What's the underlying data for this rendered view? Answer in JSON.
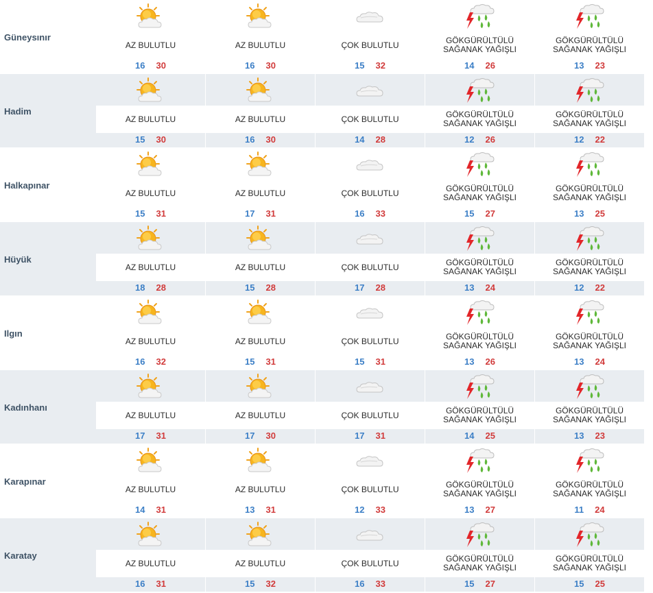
{
  "colors": {
    "low": "#3c7fc6",
    "high": "#d13b3b",
    "city": "#3f5366"
  },
  "cities": [
    {
      "name": "Güneysınır",
      "days": [
        {
          "icon": "sun-cloud-icon",
          "desc": "AZ BULUTLU",
          "low": "16",
          "high": "30"
        },
        {
          "icon": "sun-cloud-icon",
          "desc": "AZ BULUTLU",
          "low": "16",
          "high": "30"
        },
        {
          "icon": "cloud-icon",
          "desc": "ÇOK BULUTLU",
          "low": "15",
          "high": "32"
        },
        {
          "icon": "thunder-rain-icon",
          "desc": "GÖKGÜRÜLTÜLÜ\nSAĞANAK YAĞIŞLI",
          "low": "14",
          "high": "26"
        },
        {
          "icon": "thunder-rain-icon",
          "desc": "GÖKGÜRÜLTÜLÜ\nSAĞANAK YAĞIŞLI",
          "low": "13",
          "high": "23"
        }
      ]
    },
    {
      "name": "Hadim",
      "days": [
        {
          "icon": "sun-cloud-icon",
          "desc": "AZ BULUTLU",
          "low": "15",
          "high": "30"
        },
        {
          "icon": "sun-cloud-icon",
          "desc": "AZ BULUTLU",
          "low": "16",
          "high": "30"
        },
        {
          "icon": "cloud-icon",
          "desc": "ÇOK BULUTLU",
          "low": "14",
          "high": "28"
        },
        {
          "icon": "thunder-rain-icon",
          "desc": "GÖKGÜRÜLTÜLÜ\nSAĞANAK YAĞIŞLI",
          "low": "12",
          "high": "26"
        },
        {
          "icon": "thunder-rain-icon",
          "desc": "GÖKGÜRÜLTÜLÜ\nSAĞANAK YAĞIŞLI",
          "low": "12",
          "high": "22"
        }
      ]
    },
    {
      "name": "Halkapınar",
      "days": [
        {
          "icon": "sun-cloud-icon",
          "desc": "AZ BULUTLU",
          "low": "15",
          "high": "31"
        },
        {
          "icon": "sun-cloud-icon",
          "desc": "AZ BULUTLU",
          "low": "17",
          "high": "31"
        },
        {
          "icon": "cloud-icon",
          "desc": "ÇOK BULUTLU",
          "low": "16",
          "high": "33"
        },
        {
          "icon": "thunder-rain-icon",
          "desc": "GÖKGÜRÜLTÜLÜ\nSAĞANAK YAĞIŞLI",
          "low": "15",
          "high": "27"
        },
        {
          "icon": "thunder-rain-icon",
          "desc": "GÖKGÜRÜLTÜLÜ\nSAĞANAK YAĞIŞLI",
          "low": "13",
          "high": "25"
        }
      ]
    },
    {
      "name": "Hüyük",
      "days": [
        {
          "icon": "sun-cloud-icon",
          "desc": "AZ BULUTLU",
          "low": "18",
          "high": "28"
        },
        {
          "icon": "sun-cloud-icon",
          "desc": "AZ BULUTLU",
          "low": "15",
          "high": "28"
        },
        {
          "icon": "cloud-icon",
          "desc": "ÇOK BULUTLU",
          "low": "17",
          "high": "28"
        },
        {
          "icon": "thunder-rain-icon",
          "desc": "GÖKGÜRÜLTÜLÜ\nSAĞANAK YAĞIŞLI",
          "low": "13",
          "high": "24"
        },
        {
          "icon": "thunder-rain-icon",
          "desc": "GÖKGÜRÜLTÜLÜ\nSAĞANAK YAĞIŞLI",
          "low": "12",
          "high": "22"
        }
      ]
    },
    {
      "name": "Ilgın",
      "days": [
        {
          "icon": "sun-cloud-icon",
          "desc": "AZ BULUTLU",
          "low": "16",
          "high": "32"
        },
        {
          "icon": "sun-cloud-icon",
          "desc": "AZ BULUTLU",
          "low": "15",
          "high": "31"
        },
        {
          "icon": "cloud-icon",
          "desc": "ÇOK BULUTLU",
          "low": "15",
          "high": "31"
        },
        {
          "icon": "thunder-rain-icon",
          "desc": "GÖKGÜRÜLTÜLÜ\nSAĞANAK YAĞIŞLI",
          "low": "13",
          "high": "26"
        },
        {
          "icon": "thunder-rain-icon",
          "desc": "GÖKGÜRÜLTÜLÜ\nSAĞANAK YAĞIŞLI",
          "low": "13",
          "high": "24"
        }
      ]
    },
    {
      "name": "Kadınhanı",
      "days": [
        {
          "icon": "sun-cloud-icon",
          "desc": "AZ BULUTLU",
          "low": "17",
          "high": "31"
        },
        {
          "icon": "sun-cloud-icon",
          "desc": "AZ BULUTLU",
          "low": "17",
          "high": "30"
        },
        {
          "icon": "cloud-icon",
          "desc": "ÇOK BULUTLU",
          "low": "17",
          "high": "31"
        },
        {
          "icon": "thunder-rain-icon",
          "desc": "GÖKGÜRÜLTÜLÜ\nSAĞANAK YAĞIŞLI",
          "low": "14",
          "high": "25"
        },
        {
          "icon": "thunder-rain-icon",
          "desc": "GÖKGÜRÜLTÜLÜ\nSAĞANAK YAĞIŞLI",
          "low": "13",
          "high": "23"
        }
      ]
    },
    {
      "name": "Karapınar",
      "days": [
        {
          "icon": "sun-cloud-icon",
          "desc": "AZ BULUTLU",
          "low": "14",
          "high": "31"
        },
        {
          "icon": "sun-cloud-icon",
          "desc": "AZ BULUTLU",
          "low": "13",
          "high": "31"
        },
        {
          "icon": "cloud-icon",
          "desc": "ÇOK BULUTLU",
          "low": "12",
          "high": "33"
        },
        {
          "icon": "thunder-rain-icon",
          "desc": "GÖKGÜRÜLTÜLÜ\nSAĞANAK YAĞIŞLI",
          "low": "13",
          "high": "27"
        },
        {
          "icon": "thunder-rain-icon",
          "desc": "GÖKGÜRÜLTÜLÜ\nSAĞANAK YAĞIŞLI",
          "low": "11",
          "high": "24"
        }
      ]
    },
    {
      "name": "Karatay",
      "days": [
        {
          "icon": "sun-cloud-icon",
          "desc": "AZ BULUTLU",
          "low": "16",
          "high": "31"
        },
        {
          "icon": "sun-cloud-icon",
          "desc": "AZ BULUTLU",
          "low": "15",
          "high": "32"
        },
        {
          "icon": "cloud-icon",
          "desc": "ÇOK BULUTLU",
          "low": "16",
          "high": "33"
        },
        {
          "icon": "thunder-rain-icon",
          "desc": "GÖKGÜRÜLTÜLÜ\nSAĞANAK YAĞIŞLI",
          "low": "15",
          "high": "27"
        },
        {
          "icon": "thunder-rain-icon",
          "desc": "GÖKGÜRÜLTÜLÜ\nSAĞANAK YAĞIŞLI",
          "low": "15",
          "high": "25"
        }
      ]
    }
  ]
}
